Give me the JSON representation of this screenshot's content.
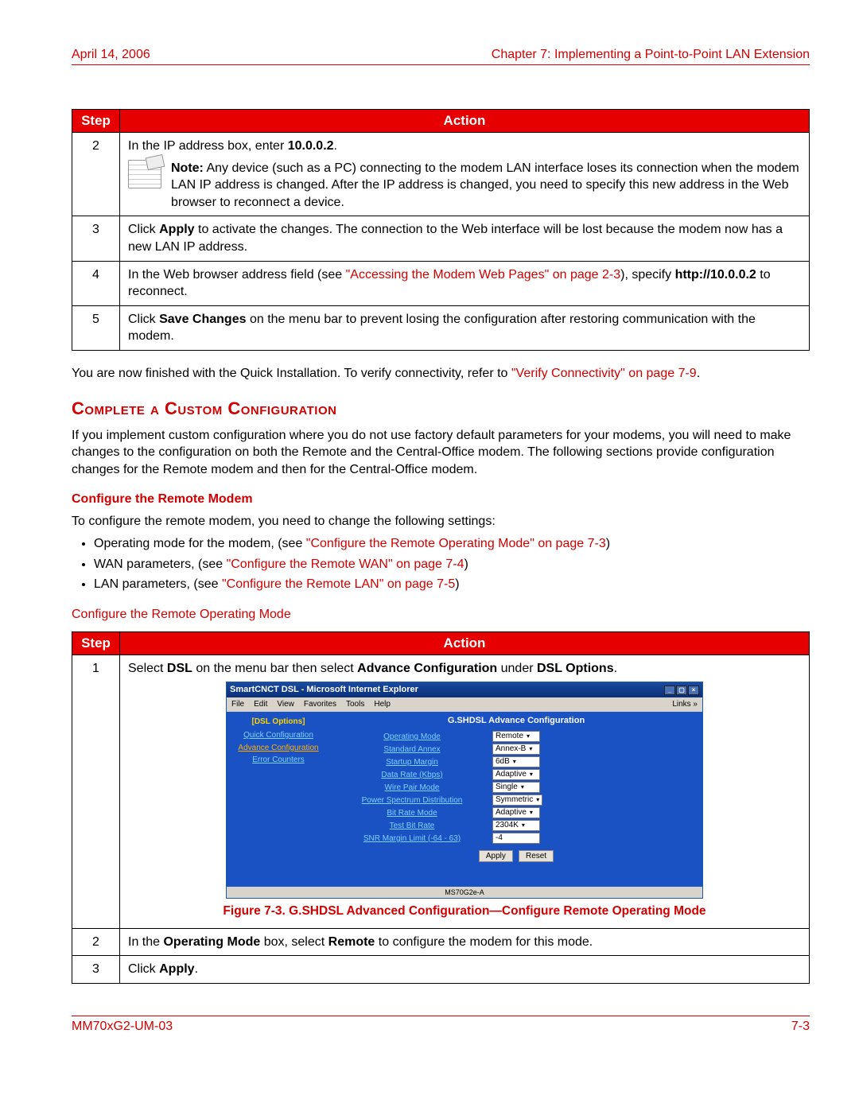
{
  "header": {
    "date": "April 14, 2006",
    "chapter": "Chapter 7: Implementing a Point-to-Point LAN Extension"
  },
  "footer": {
    "docnum": "MM70xG2-UM-03",
    "pagenum": "7-3"
  },
  "table1": {
    "step_header": "Step",
    "action_header": "Action",
    "rows": {
      "r2num": "2",
      "r2_pre": "In the IP address box, enter ",
      "r2_ip": "10.0.0.2",
      "r2_post": ".",
      "r2_note_label": "Note:",
      "r2_note_body": " Any device (such as a PC) connecting to the modem LAN interface loses its connection when the modem LAN IP address is changed. After the IP address is changed, you need to specify this new address in the Web browser to reconnect a device.",
      "r3num": "3",
      "r3_a": "Click ",
      "r3_b": "Apply",
      "r3_c": " to activate the changes. The connection to the Web interface will be lost because the modem now has a new LAN IP address.",
      "r4num": "4",
      "r4_a": "In the Web browser address field (see ",
      "r4_link": "\"Accessing the Modem Web Pages\" on page 2-3",
      "r4_b": "), specify ",
      "r4_url": "http://10.0.0.2",
      "r4_c": " to reconnect.",
      "r5num": "5",
      "r5_a": "Click ",
      "r5_b": "Save Changes",
      "r5_c": " on the menu bar to prevent losing the configuration after restoring communication with the modem."
    }
  },
  "afterTable1_a": "You are now finished with the Quick Installation. To verify connectivity, refer to ",
  "afterTable1_link": "\"Verify Connectivity\" on page 7-9",
  "afterTable1_b": ".",
  "h2": "Complete a Custom Configuration",
  "customPara": "If you implement custom configuration where you do not use factory default parameters for your modems, you will need to make changes to the configuration on both the Remote and the Central-Office modem. The following sections provide configuration changes for the Remote modem and then for the Central-Office modem.",
  "h3": "Configure the Remote Modem",
  "remoteIntro": "To configure the remote modem, you need to change the following settings:",
  "bullets": {
    "b1a": "Operating mode for the modem, (see ",
    "b1l": "\"Configure the Remote Operating Mode\" on page 7-3",
    "b1b": ")",
    "b2a": "WAN parameters, (see ",
    "b2l": "\"Configure the Remote WAN\" on page 7-4",
    "b2b": ")",
    "b3a": "LAN parameters, (see ",
    "b3l": "\"Configure the Remote LAN\" on page 7-5",
    "b3b": ")"
  },
  "h4": "Configure the Remote Operating Mode",
  "table2": {
    "step_header": "Step",
    "action_header": "Action",
    "r1num": "1",
    "r1_a": "Select ",
    "r1_b": "DSL",
    "r1_c": " on the menu bar then select ",
    "r1_d": "Advance Configuration",
    "r1_e": " under ",
    "r1_f": "DSL Options",
    "r1_g": ".",
    "figcap": "Figure 7-3. G.SHDSL Advanced Configuration—Configure Remote Operating Mode",
    "r2num": "2",
    "r2_a": "In the ",
    "r2_b": "Operating Mode",
    "r2_c": " box, select ",
    "r2_d": "Remote",
    "r2_e": " to configure the modem for this mode.",
    "r3num": "3",
    "r3_a": "Click ",
    "r3_b": "Apply",
    "r3_c": "."
  },
  "shot": {
    "title": "SmartCNCT DSL - Microsoft Internet Explorer",
    "menus": {
      "file": "File",
      "edit": "Edit",
      "view": "View",
      "fav": "Favorites",
      "tools": "Tools",
      "help": "Help",
      "links": "Links »"
    },
    "sidecat": "[DSL Options]",
    "sidelinks": {
      "quick": "Quick Configuration",
      "adv": "Advance Configuration",
      "err": "Error Counters"
    },
    "heading": "G.SHDSL Advance Configuration",
    "rows": {
      "opmode_l": "Operating Mode",
      "opmode_v": "Remote",
      "annex_l": "Standard Annex",
      "annex_v": "Annex-B",
      "margin_l": "Startup Margin",
      "margin_v": "6dB",
      "rate_l": "Data Rate (Kbps)",
      "rate_v": "Adaptive",
      "wire_l": "Wire Pair Mode",
      "wire_v": "Single",
      "psd_l": "Power Spectrum Distribution",
      "psd_v": "Symmetric",
      "bitmode_l": "Bit Rate Mode",
      "bitmode_v": "Adaptive",
      "testbit_l": "Test Bit Rate",
      "testbit_v": "2304K",
      "snr_l": "SNR Margin Limit (-64 - 63)",
      "snr_v": "-4"
    },
    "apply": "Apply",
    "reset": "Reset",
    "status": "MS70G2e-A"
  }
}
